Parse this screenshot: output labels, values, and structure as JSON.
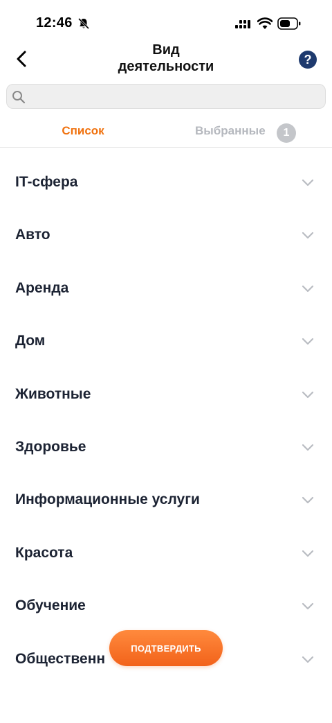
{
  "status": {
    "time": "12:46"
  },
  "header": {
    "title_line1": "Вид",
    "title_line2": "деятельности",
    "help_label": "?"
  },
  "search": {
    "placeholder": "",
    "value": ""
  },
  "tabs": {
    "list_label": "Список",
    "selected_label": "Выбранные",
    "selected_count": "1"
  },
  "categories": [
    "IT-сфера",
    "Авто",
    "Аренда",
    "Дом",
    "Животные",
    "Здоровье",
    "Информационные услуги",
    "Красота",
    "Обучение",
    "Общественн"
  ],
  "confirm_label": "ПОДТВЕРДИТЬ",
  "colors": {
    "accent": "#f0720f",
    "help_bg": "#1e3a6e",
    "text": "#1c2333",
    "muted": "#b5b8be"
  },
  "icons": [
    "bell-slash-icon",
    "signal-icon",
    "wifi-icon",
    "battery-icon",
    "back-arrow-icon",
    "search-icon",
    "chevron-down-icon"
  ]
}
